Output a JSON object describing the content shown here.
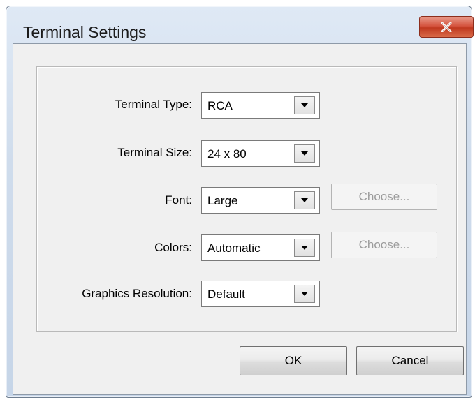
{
  "window": {
    "title": "Terminal Settings",
    "close_icon": "close-icon",
    "close_color": "#c7432a"
  },
  "form": {
    "rows": [
      {
        "label": "Terminal Type:",
        "value": "RCA"
      },
      {
        "label": "Terminal Size:",
        "value": "24 x 80"
      },
      {
        "label": "Font:",
        "value": "Large",
        "button": "Choose..."
      },
      {
        "label": "Colors:",
        "value": "Automatic",
        "button": "Choose..."
      },
      {
        "label": "Graphics Resolution:",
        "value": "Default"
      }
    ]
  },
  "footer": {
    "ok_label": "OK",
    "cancel_label": "Cancel"
  }
}
